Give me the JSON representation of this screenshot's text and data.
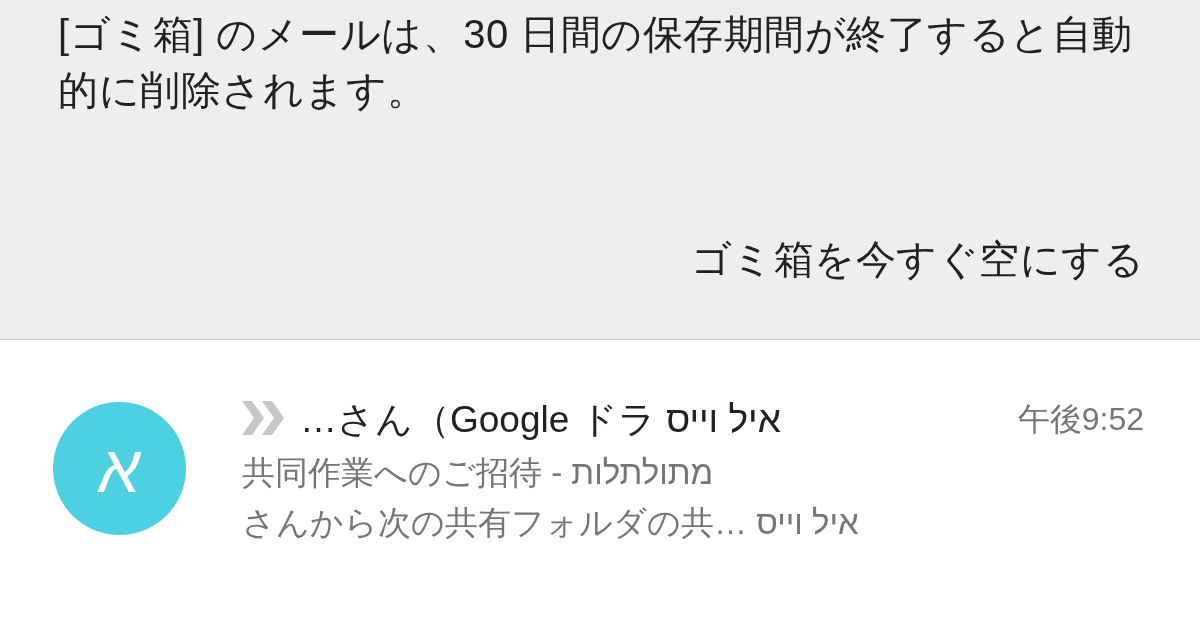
{
  "trash_banner": {
    "message": "[ゴミ箱] のメールは、30 日間の保存期間が終了すると自動的に削除されます。",
    "action": "ゴミ箱を今すぐ空にする"
  },
  "messages": [
    {
      "avatar_letter": "א",
      "color": "#4dd0e1",
      "important": true,
      "sender": "…さん（Google ドラ איל וייס",
      "time": "午後9:52",
      "subject": "共同作業へのご招待 - מתולתלות",
      "snippet": "さんから次の共有フォルダの共… איל וייס",
      "unread": true
    }
  ]
}
